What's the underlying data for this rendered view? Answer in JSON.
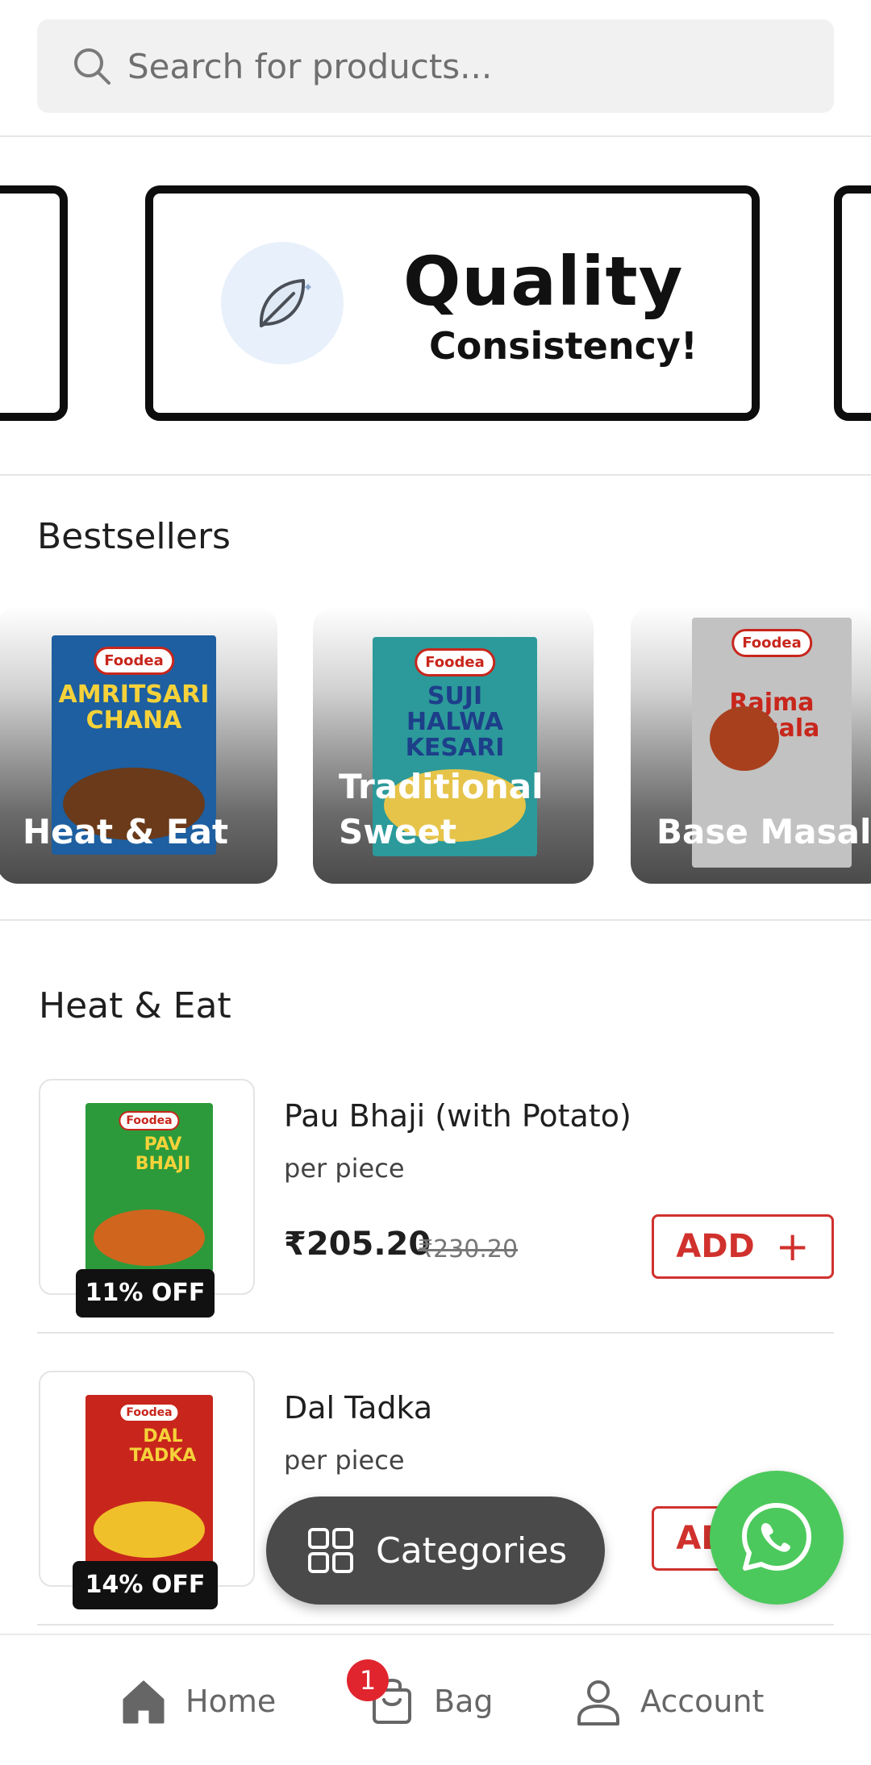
{
  "search": {
    "placeholder": "Search for products..."
  },
  "banner": {
    "title": "Quality",
    "subtitle": "Consistency!",
    "icon": "leaf-icon"
  },
  "bestsellers": {
    "title": "Bestsellers",
    "items": [
      {
        "label": "Heat & Eat",
        "pack_name": "AMRITSARI CHANA",
        "pack_color": "#1d5fa0"
      },
      {
        "label": "Traditional Sweet",
        "pack_name": "SUJI HALWA KESARI",
        "pack_color": "#2c9a9a"
      },
      {
        "label": "Base Masala",
        "pack_name": "Rajma Masala",
        "pack_color": "#b9b9b9"
      }
    ],
    "brand": "Foodea"
  },
  "heat_eat": {
    "title": "Heat & Eat",
    "products": [
      {
        "name": "Pau Bhaji (with Potato)",
        "unit": "per piece",
        "price": "₹205.20",
        "mrp": "₹230.20",
        "discount": "11% OFF",
        "add_label": "ADD",
        "pack_name": "PAV BHAJI",
        "pack_color": "#2c9a3a"
      },
      {
        "name": "Dal Tadka",
        "unit": "per piece",
        "price": "",
        "mrp": "",
        "discount": "14% OFF",
        "add_label": "ADD",
        "pack_name": "DAL TADKA",
        "pack_color": "#c8261c"
      }
    ]
  },
  "floating": {
    "categories_label": "Categories"
  },
  "nav": {
    "home": "Home",
    "bag": "Bag",
    "bag_count": "1",
    "account": "Account"
  },
  "colors": {
    "accent": "#d0312d",
    "whatsapp": "#4cc95c",
    "badge": "#e0252e",
    "fab": "#4a4a4a"
  }
}
